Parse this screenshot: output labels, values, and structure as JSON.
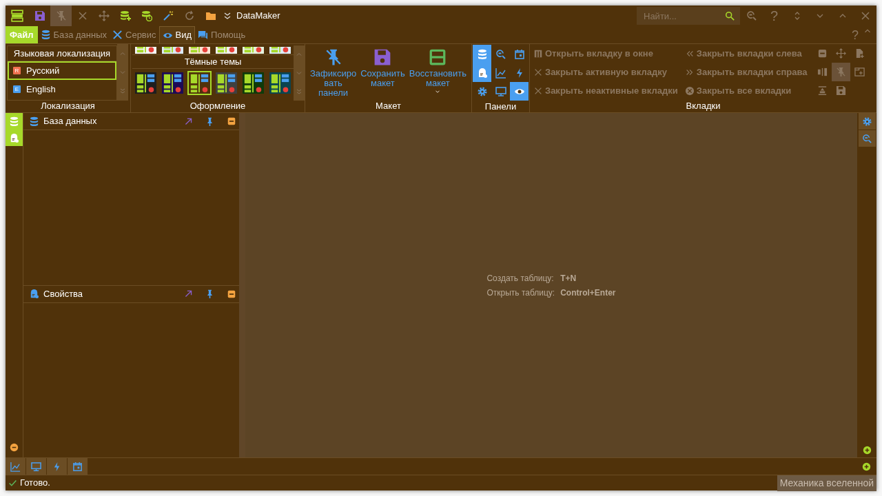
{
  "window": {
    "title": "DataMaker"
  },
  "quick_toolbar": [
    {
      "kind": "save",
      "disabled": false,
      "pressed": false
    },
    {
      "kind": "pin-off",
      "disabled": true,
      "pressed": true
    },
    {
      "kind": "close",
      "disabled": true,
      "pressed": false
    },
    {
      "kind": "move",
      "disabled": true,
      "pressed": false
    },
    {
      "kind": "db-plus",
      "disabled": false,
      "pressed": false
    },
    {
      "kind": "db-clock",
      "disabled": false,
      "pressed": false
    },
    {
      "kind": "wand",
      "disabled": false,
      "pressed": false
    },
    {
      "kind": "refresh",
      "disabled": true,
      "pressed": false
    },
    {
      "kind": "folder",
      "disabled": false,
      "pressed": false
    },
    {
      "kind": "overflow",
      "disabled": false,
      "pressed": false
    }
  ],
  "search": {
    "placeholder": "Найти..."
  },
  "title_buttons": [
    {
      "kind": "search-refresh"
    },
    {
      "kind": "help",
      "label": "?"
    },
    {
      "kind": "updown"
    },
    {
      "kind": "down"
    },
    {
      "kind": "up"
    },
    {
      "kind": "close"
    }
  ],
  "menu": [
    {
      "kind": "file",
      "label": "Файл",
      "selected": false
    },
    {
      "kind": "database",
      "label": "База данных",
      "selected": false
    },
    {
      "kind": "tools",
      "label": "Сервис",
      "selected": false
    },
    {
      "kind": "eye",
      "label": "Вид",
      "selected": true
    },
    {
      "kind": "chat",
      "label": "Помощь",
      "selected": false
    }
  ],
  "menu_help": "?",
  "localization": {
    "header": "Языковая локализация",
    "caption": "Локализация",
    "items": [
      {
        "badge": "R",
        "label": "Русский",
        "color": "#f0704f",
        "selected": true
      },
      {
        "badge": "E",
        "label": "English",
        "color": "#4a9ff0",
        "selected": false
      }
    ]
  },
  "appearance": {
    "caption": "Оформление",
    "dark_header": "Тёмные темы",
    "light_themes": [
      {
        "color": "#f4f4f4",
        "selected": false
      },
      {
        "color": "#dce9f5",
        "selected": false
      },
      {
        "color": "#fbe4d2",
        "selected": false
      },
      {
        "color": "#f0f0f0",
        "selected": false
      },
      {
        "color": "#e5f2dd",
        "selected": false
      },
      {
        "color": "#dcecf6",
        "selected": false
      }
    ],
    "dark_themes": [
      {
        "color": "#1e1e1e",
        "selected": false
      },
      {
        "color": "#1c0a56",
        "selected": false
      },
      {
        "color": "#50320a",
        "selected": true
      },
      {
        "color": "#404040",
        "selected": false
      },
      {
        "color": "#0f3a0a",
        "selected": false
      },
      {
        "color": "#0a4450",
        "selected": false
      }
    ]
  },
  "layout": {
    "caption": "Макет",
    "buttons": [
      {
        "kind": "pin-off",
        "lines": [
          "Зафиксиро",
          "вать",
          "панели"
        ],
        "dropdown": false
      },
      {
        "kind": "save",
        "lines": [
          "Сохранить",
          "макет"
        ],
        "dropdown": false
      },
      {
        "kind": "restore",
        "lines": [
          "Восстановить",
          "макет"
        ],
        "dropdown": true
      }
    ]
  },
  "panels": {
    "caption": "Панели",
    "toggles": [
      {
        "kind": "database",
        "on": true
      },
      {
        "kind": "search-refresh",
        "on": false
      },
      {
        "kind": "calendar",
        "on": false
      },
      {
        "kind": "props",
        "on": true
      },
      {
        "kind": "chart",
        "on": false
      },
      {
        "kind": "bolt",
        "on": false
      },
      {
        "kind": "gear",
        "on": false
      },
      {
        "kind": "monitor",
        "on": false
      },
      {
        "kind": "eye",
        "on": true
      }
    ]
  },
  "tabs_group": {
    "caption": "Вкладки",
    "actions": [
      {
        "kind": "window",
        "label": "Открыть вкладку в окне",
        "disabled": true
      },
      {
        "kind": "close",
        "label": "Закрыть активную вкладку",
        "disabled": true
      },
      {
        "kind": "close",
        "label": "Закрыть неактивные вкладки",
        "disabled": true
      },
      {
        "kind": "left",
        "label": "Закрыть вкладки слева",
        "disabled": true
      },
      {
        "kind": "right",
        "label": "Закрыть вкладки справа",
        "disabled": true
      },
      {
        "kind": "close-circle",
        "label": "Закрыть все вкладки",
        "disabled": true
      }
    ],
    "icons": [
      {
        "kind": "minus-square",
        "pressed": false
      },
      {
        "kind": "move",
        "pressed": false
      },
      {
        "kind": "file-add",
        "pressed": false
      },
      {
        "kind": "split",
        "pressed": false
      },
      {
        "kind": "pin-off",
        "pressed": true
      },
      {
        "kind": "window-add",
        "pressed": false
      },
      {
        "kind": "align",
        "pressed": false
      },
      {
        "kind": "save",
        "pressed": false
      }
    ]
  },
  "left_dock": [
    {
      "kind": "database",
      "selected": true
    },
    {
      "kind": "props",
      "selected": true
    }
  ],
  "docked_panels": [
    {
      "kind": "database",
      "title": "База данных"
    },
    {
      "kind": "props",
      "title": "Свойства"
    }
  ],
  "hints": [
    {
      "label": "Создать таблицу:",
      "keys": "T+N"
    },
    {
      "label": "Открыть таблицу:",
      "keys": "Control+Enter"
    }
  ],
  "right_dock": [
    {
      "kind": "gear"
    },
    {
      "kind": "search-refresh"
    }
  ],
  "bottom_dock": [
    {
      "kind": "chart"
    },
    {
      "kind": "monitor"
    },
    {
      "kind": "bolt"
    },
    {
      "kind": "calendar"
    }
  ],
  "status_bar": {
    "text": "Готово.",
    "right_text": "Механика вселенной"
  }
}
